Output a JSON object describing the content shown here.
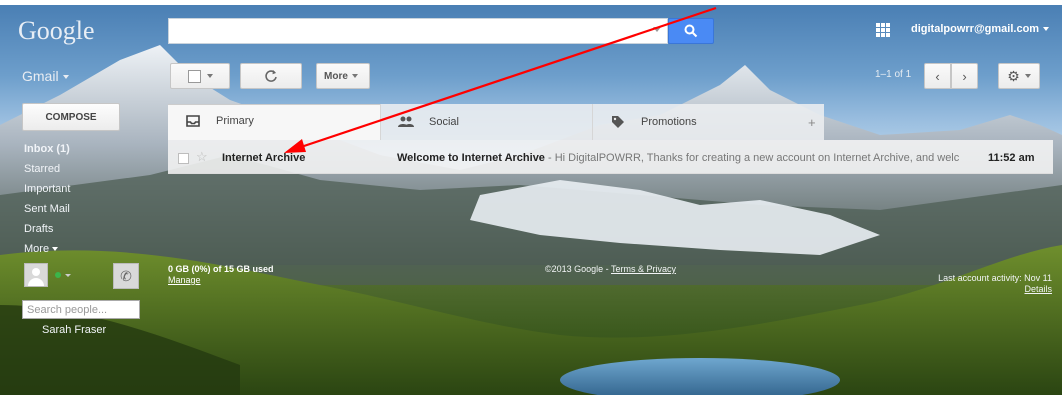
{
  "header": {
    "logo": "Google",
    "search_value": "",
    "account": "digitalpowrr@gmail.com"
  },
  "toolbar": {
    "app_label": "Gmail",
    "more_label": "More",
    "pager": "1–1 of 1"
  },
  "sidebar": {
    "compose_label": "COMPOSE",
    "items": [
      {
        "label": "Inbox (1)",
        "bold": true
      },
      {
        "label": "Starred"
      },
      {
        "label": "Important"
      },
      {
        "label": "Sent Mail"
      },
      {
        "label": "Drafts"
      },
      {
        "label": "More"
      }
    ],
    "people_search_placeholder": "Search people...",
    "contact_name": "Sarah Fraser"
  },
  "tabs": [
    {
      "label": "Primary",
      "icon": "inbox-icon"
    },
    {
      "label": "Social",
      "icon": "people-icon"
    },
    {
      "label": "Promotions",
      "icon": "tag-icon"
    }
  ],
  "messages": [
    {
      "sender": "Internet Archive",
      "subject": "Welcome to Internet Archive",
      "snippet": " - Hi DigitalPOWRR, Thanks for creating a new account on Internet Archive, and welc",
      "time": "11:52 am"
    }
  ],
  "footer": {
    "storage": "0 GB (0%) of 15 GB used",
    "manage": "Manage",
    "copyright": "©2013 Google - ",
    "terms": "Terms & Privacy",
    "activity": "Last account activity: Nov 11",
    "details": "Details"
  },
  "colors": {
    "search_button": "#4a8af4",
    "annotation_arrow": "#ff0000",
    "status_online": "#3bb54a"
  }
}
